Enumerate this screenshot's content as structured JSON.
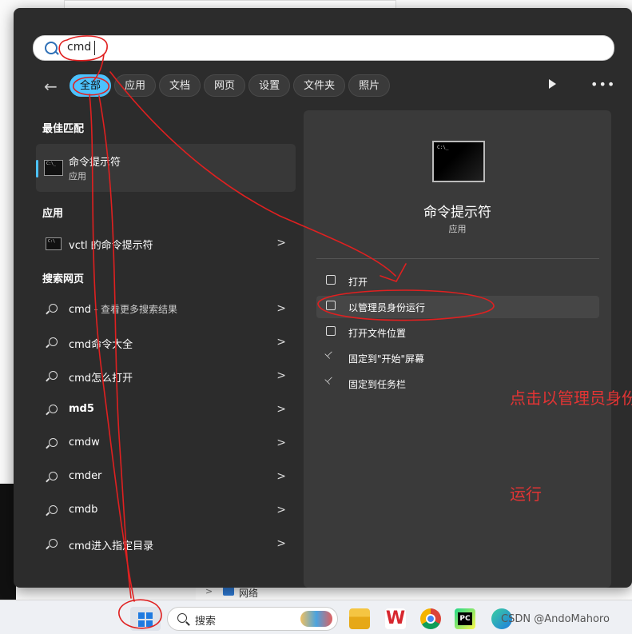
{
  "search": {
    "value": "cmd"
  },
  "filters": [
    {
      "label": "全部",
      "active": true
    },
    {
      "label": "应用"
    },
    {
      "label": "文档"
    },
    {
      "label": "网页"
    },
    {
      "label": "设置"
    },
    {
      "label": "文件夹"
    },
    {
      "label": "照片"
    }
  ],
  "sections": {
    "best_match": "最佳匹配",
    "apps": "应用",
    "web": "搜索网页"
  },
  "best_match": {
    "name": "命令提示符",
    "type": "应用"
  },
  "apps": [
    {
      "label": "vctl 的命令提示符"
    }
  ],
  "web_results": [
    {
      "main": "cmd",
      "sub": " - 查看更多搜索结果"
    },
    {
      "main": "cmd命令大全"
    },
    {
      "main": "cmd怎么打开"
    },
    {
      "main": "md5"
    },
    {
      "main": "cmdw"
    },
    {
      "main": "cmder"
    },
    {
      "main": "cmdb"
    },
    {
      "main": "cmd进入指定目录"
    }
  ],
  "detail": {
    "title": "命令提示符",
    "subtitle": "应用",
    "actions": [
      {
        "label": "打开",
        "icon": "open-external-icon"
      },
      {
        "label": "以管理员身份运行",
        "icon": "shield-icon"
      },
      {
        "label": "打开文件位置",
        "icon": "folder-icon"
      },
      {
        "label": "固定到\"开始\"屏幕",
        "icon": "pin-icon"
      },
      {
        "label": "固定到任务栏",
        "icon": "pin-icon"
      }
    ]
  },
  "annotation": {
    "line1": "点击以管理员身份",
    "line2": "运行"
  },
  "taskbar": {
    "search_placeholder": "搜索"
  },
  "background": {
    "network_label": "网络"
  },
  "watermark": "CSDN @AndoMahoro",
  "colors": {
    "accent": "#4cc2ff",
    "annotation": "#e23434",
    "panel": "#2c2c2c"
  }
}
